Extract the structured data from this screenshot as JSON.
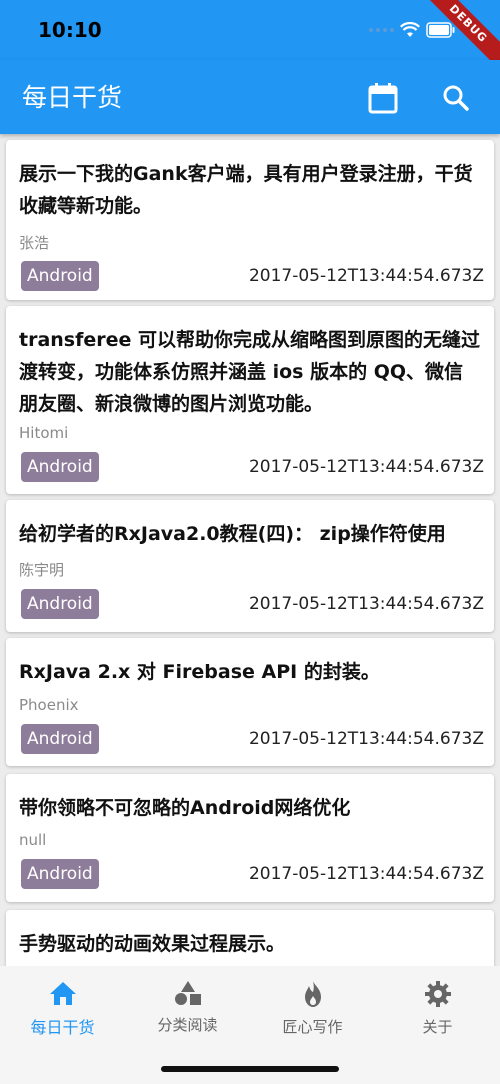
{
  "status": {
    "time": "10:10",
    "debug": "DEBUG"
  },
  "appbar": {
    "title": "每日干货"
  },
  "cards": [
    {
      "title": "展示一下我的Gank客户端，具有用户登录注册，干货收藏等新功能。",
      "author": "张浩",
      "tag": "Android",
      "date": "2017-05-12T13:44:54.673Z"
    },
    {
      "title": "transferee 可以帮助你完成从缩略图到原图的无缝过渡转变，功能体系仿照并涵盖 ios 版本的 QQ、微信朋友圈、新浪微博的图片浏览功能。",
      "author": "Hitomi",
      "tag": "Android",
      "date": "2017-05-12T13:44:54.673Z"
    },
    {
      "title": "给初学者的RxJava2.0教程(四)： zip操作符使用",
      "author": "陈宇明",
      "tag": "Android",
      "date": "2017-05-12T13:44:54.673Z"
    },
    {
      "title": "RxJava 2.x 对 Firebase API 的封装。",
      "author": "Phoenix",
      "tag": "Android",
      "date": "2017-05-12T13:44:54.673Z"
    },
    {
      "title": "带你领略不可忽略的Android网络优化",
      "author": "null",
      "tag": "Android",
      "date": "2017-05-12T13:44:54.673Z"
    },
    {
      "title": "手势驱动的动画效果过程展示。",
      "author": "",
      "tag": "",
      "date": ""
    }
  ],
  "nav": [
    {
      "label": "每日干货",
      "icon": "home-icon",
      "active": true
    },
    {
      "label": "分类阅读",
      "icon": "category-icon",
      "active": false
    },
    {
      "label": "匠心写作",
      "icon": "fire-icon",
      "active": false
    },
    {
      "label": "关于",
      "icon": "gear-icon",
      "active": false
    }
  ],
  "colors": {
    "primary": "#2196f3",
    "tag": "#8e7d9a"
  }
}
